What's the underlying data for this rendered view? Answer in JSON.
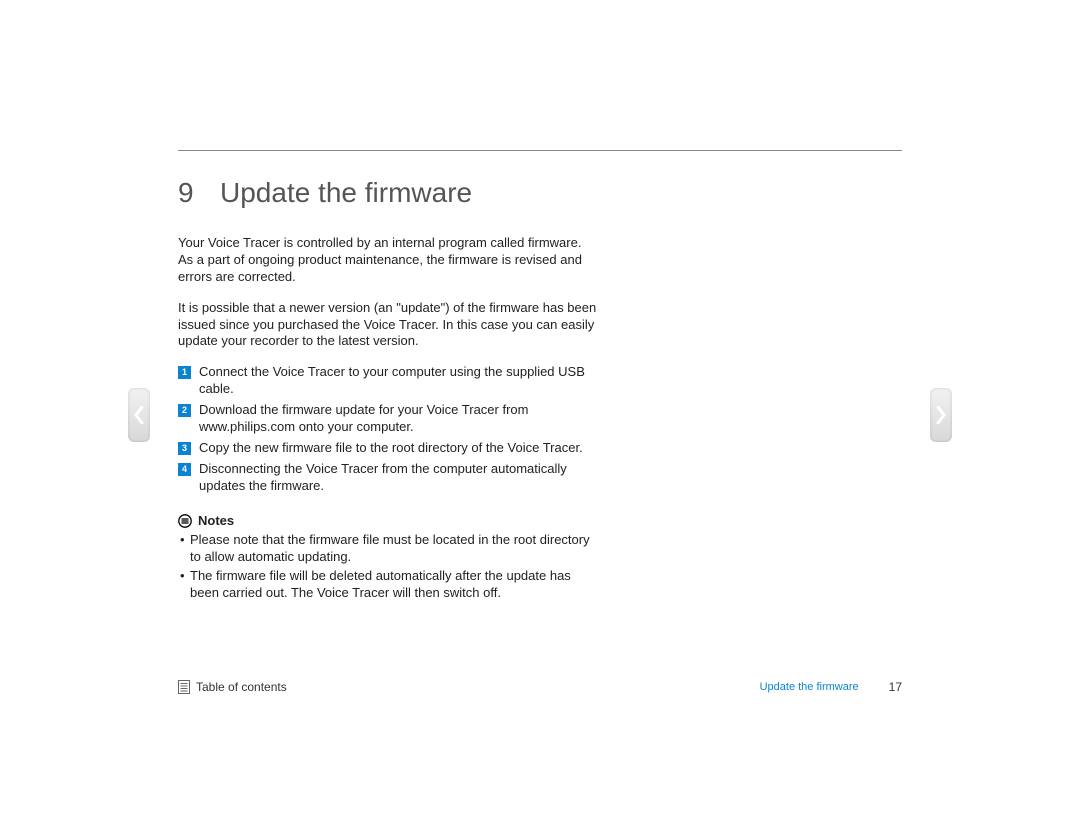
{
  "chapter": {
    "number": "9",
    "title": "Update the firmware"
  },
  "paragraphs": {
    "p1": "Your Voice Tracer is controlled by an internal program called firmware. As a part of ongoing product maintenance, the firmware is revised and errors are corrected.",
    "p2": "It is possible that a newer version (an \"update\") of the firmware has been issued since you purchased the Voice Tracer. In this case you can easily update your recorder to the latest version."
  },
  "steps": [
    {
      "n": "1",
      "text": "Connect the Voice Tracer to your computer using the supplied USB cable."
    },
    {
      "n": "2",
      "text": "Download the firmware update for your Voice Tracer from www.philips.com onto your computer."
    },
    {
      "n": "3",
      "text": "Copy the new firmware file to the root directory of the Voice Tracer."
    },
    {
      "n": "4",
      "text": "Disconnecting the Voice Tracer from the computer automatically updates the firmware."
    }
  ],
  "notes": {
    "heading": "Notes",
    "items": [
      "Please note that the firmware file must be located in the root directory to allow automatic updating.",
      "The firmware file will be deleted automatically after the update has been carried out. The Voice Tracer will then switch off."
    ]
  },
  "footer": {
    "toc": "Table of contents",
    "section": "Update the firmware",
    "page": "17"
  }
}
